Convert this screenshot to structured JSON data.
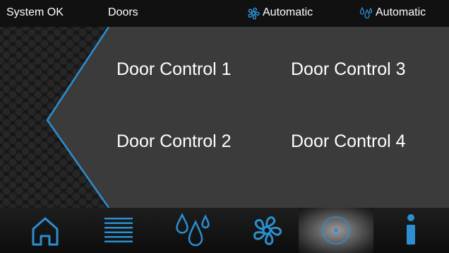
{
  "status_bar": {
    "system_status": "System OK",
    "page_name": "Doors",
    "fan_mode": "Automatic",
    "water_mode": "Automatic"
  },
  "doors": {
    "items": [
      {
        "label": "Door Control 1"
      },
      {
        "label": "Door Control 2"
      },
      {
        "label": "Door Control 3"
      },
      {
        "label": "Door Control 4"
      }
    ]
  },
  "nav": {
    "items": [
      {
        "icon": "home-icon"
      },
      {
        "icon": "menu-lines-icon"
      },
      {
        "icon": "water-drops-icon"
      },
      {
        "icon": "fan-icon"
      },
      {
        "icon": "door-knob-icon",
        "active": true
      },
      {
        "icon": "info-icon"
      }
    ]
  },
  "colors": {
    "accent": "#2b8fd0",
    "panel": "#3b3b3b",
    "status_bar": "#111111",
    "background": "#1b1b1b"
  }
}
